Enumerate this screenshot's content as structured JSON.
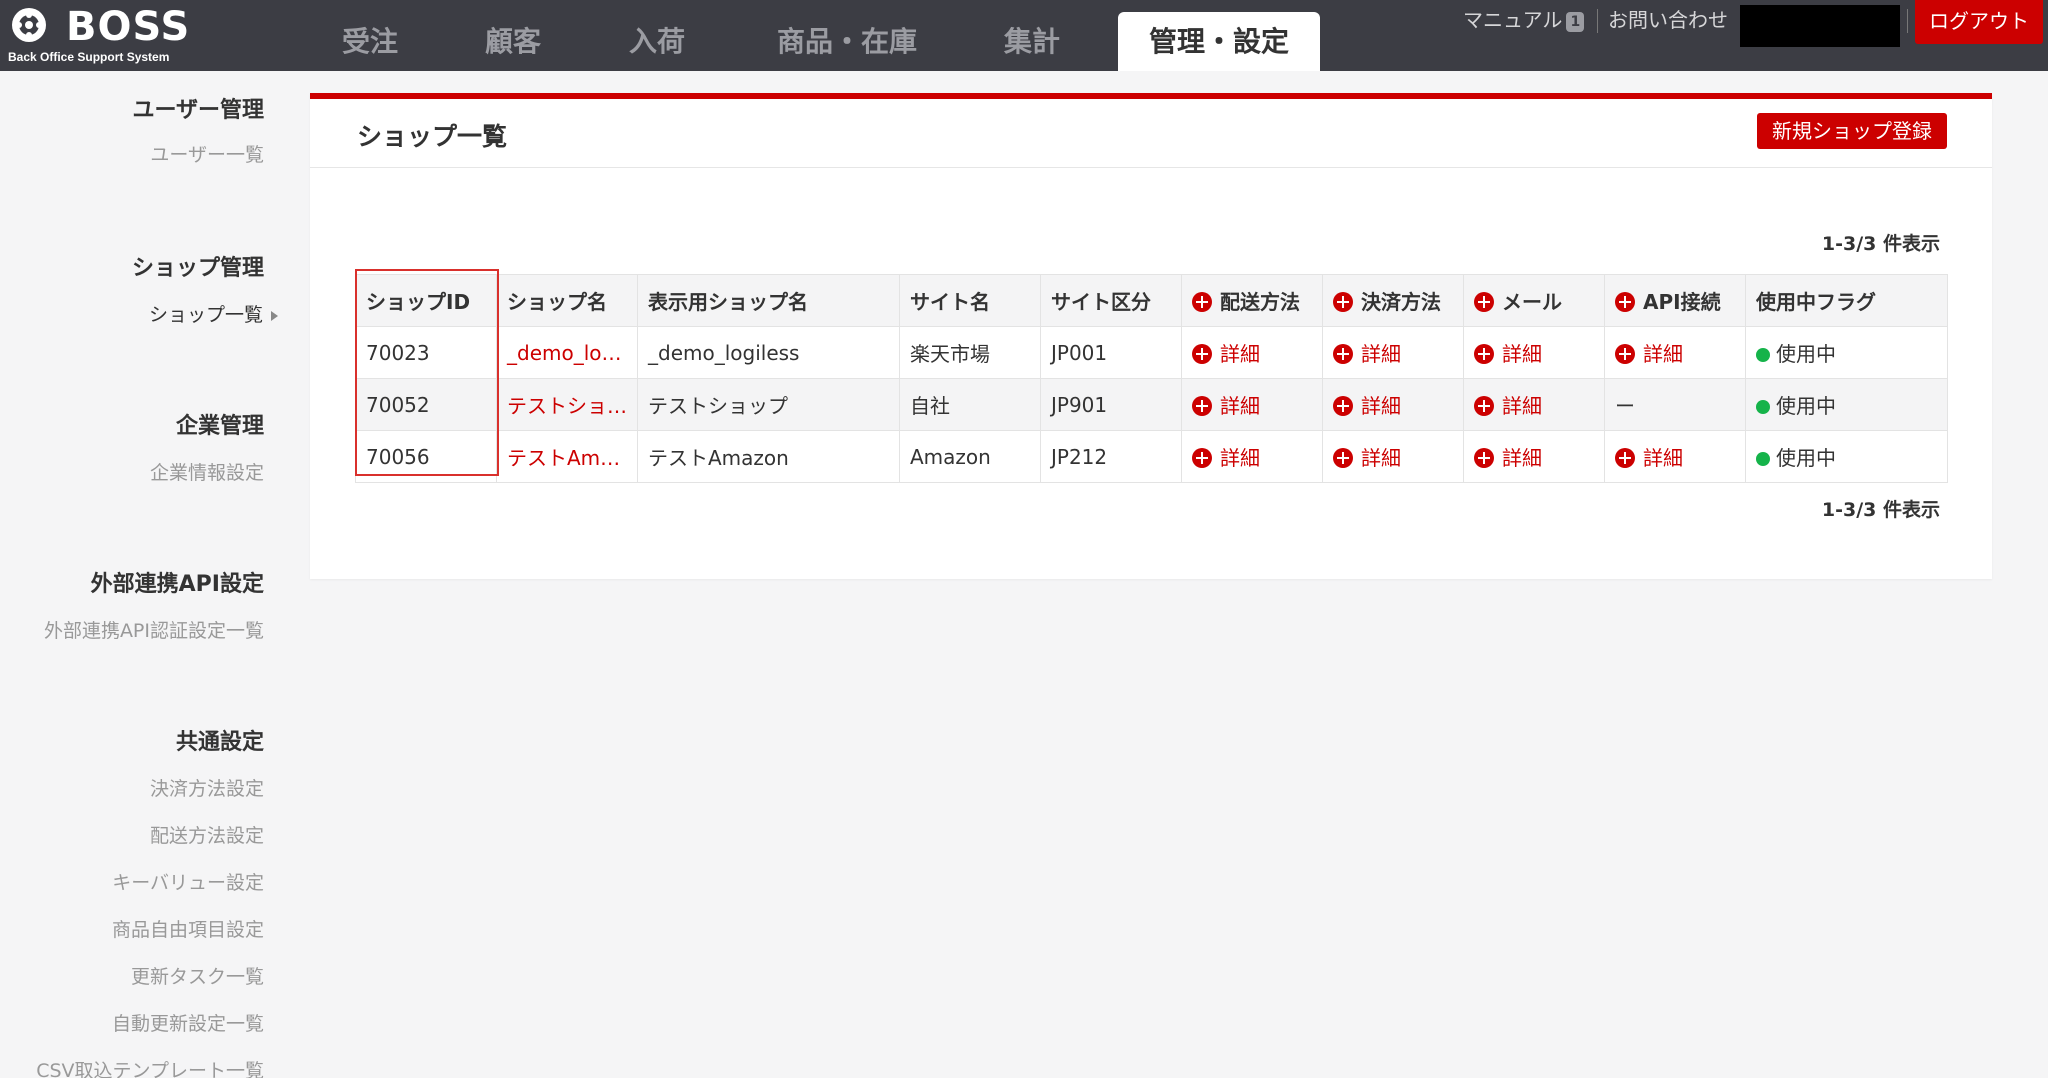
{
  "header": {
    "logo_title": "BOSS",
    "logo_subtitle": "Back Office Support System",
    "tabs": [
      "受注",
      "顧客",
      "入荷",
      "商品・在庫",
      "集計",
      "管理・設定"
    ],
    "manual_label": "マニュアル",
    "manual_badge": "1",
    "contact_label": "お問い合わせ",
    "logout_label": "ログアウト"
  },
  "sidebar": {
    "user_mgmt": "ユーザー管理",
    "user_list": "ユーザー一覧",
    "shop_mgmt": "ショップ管理",
    "shop_list": "ショップ一覧",
    "company_mgmt": "企業管理",
    "company_info": "企業情報設定",
    "api_settings": "外部連携API設定",
    "api_auth_list": "外部連携API認証設定一覧",
    "common_settings": "共通設定",
    "payment_settings": "決済方法設定",
    "shipping_settings": "配送方法設定",
    "keyvalue_settings": "キーバリュー設定",
    "free_item_settings": "商品自由項目設定",
    "update_task_list": "更新タスク一覧",
    "auto_update_list": "自動更新設定一覧",
    "csv_template_list": "CSV取込テンプレート一覧"
  },
  "panel": {
    "title": "ショップ一覧",
    "new_button": "新規ショップ登録",
    "count_top": "1-3/3 件表示",
    "count_bottom": "1-3/3 件表示"
  },
  "table": {
    "headers": [
      "ショップID",
      "ショップ名",
      "表示用ショップ名",
      "サイト名",
      "サイト区分",
      "配送方法",
      "決済方法",
      "メール",
      "API接続",
      "使用中フラグ"
    ],
    "rows": [
      {
        "id": "70023",
        "name": "_demo_logiless",
        "display": "_demo_logiless",
        "site": "楽天市場",
        "site_type": "JP001",
        "shipping": "詳細",
        "payment": "詳細",
        "mail": "詳細",
        "api": "詳細",
        "flag": "使用中"
      },
      {
        "id": "70052",
        "name": "テストショップ",
        "display": "テストショップ",
        "site": "自社",
        "site_type": "JP901",
        "shipping": "詳細",
        "payment": "詳細",
        "mail": "詳細",
        "api": "ー",
        "flag": "使用中"
      },
      {
        "id": "70056",
        "name": "テストAmazon",
        "display": "テストAmazon",
        "site": "Amazon",
        "site_type": "JP212",
        "shipping": "詳細",
        "payment": "詳細",
        "mail": "詳細",
        "api": "詳細",
        "flag": "使用中"
      }
    ]
  },
  "colors": {
    "accent": "#cc0000",
    "header_bg": "#3c3d44",
    "status_ok": "#15b34a"
  }
}
